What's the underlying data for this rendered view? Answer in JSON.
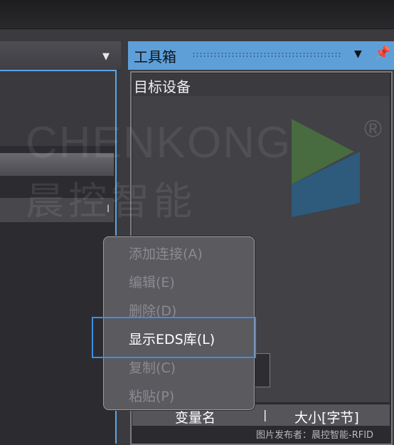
{
  "left_panel": {
    "dropdown_icon": "triangle-down-icon",
    "caret_icon": "text-caret-icon"
  },
  "toolbox": {
    "title": "工具箱",
    "dropdown_icon": "triangle-down-icon",
    "pin_icon": "pin-icon",
    "section_title": "目标设备",
    "table_columns": [
      "变量名",
      "大小[字节]"
    ],
    "accent_color": "#5f9fd8"
  },
  "context_menu": {
    "items": [
      {
        "label": "添加连接(A)",
        "enabled": false
      },
      {
        "label": "编辑(E)",
        "enabled": false
      },
      {
        "label": "删除(D)",
        "enabled": false
      },
      {
        "label": "显示EDS库(L)",
        "enabled": true,
        "highlighted": true
      },
      {
        "label": "复制(C)",
        "enabled": false
      },
      {
        "label": "粘贴(P)",
        "enabled": false
      }
    ],
    "highlight_color": "#3f8fe0"
  },
  "watermark": {
    "text": "CHENKONG",
    "text_cn": "晨控智能",
    "registered_mark": "®",
    "logo_icon": "chenkong-logo-icon"
  },
  "caption": "图片发布者：晨控智能-RFID"
}
